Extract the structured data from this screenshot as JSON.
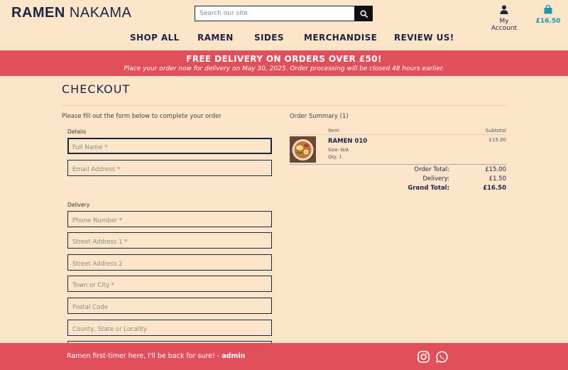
{
  "brand": {
    "name_bold": "RAMEN",
    "name_rest": "NAKAMA"
  },
  "search": {
    "placeholder": "Search our site",
    "icon": "search-icon"
  },
  "account": {
    "label": "My Account",
    "icon": "user-icon"
  },
  "cart": {
    "total": "£16.50",
    "icon": "shopping-bag-icon"
  },
  "nav": [
    "SHOP ALL",
    "RAMEN",
    "SIDES",
    "MERCHANDISE",
    "REVIEW US!"
  ],
  "banner": {
    "headline": "FREE DELIVERY ON ORDERS OVER £50!",
    "subline": "Place your order now for delivery on May 30, 2025. Order processing will be closed 48 hours earlier."
  },
  "page": {
    "title": "CHECKOUT",
    "intro": "Please fill out the form below to complete your order"
  },
  "form": {
    "details_label": "Details",
    "details_fields": [
      {
        "placeholder": "Full Name *",
        "value": ""
      },
      {
        "placeholder": "Email Address *",
        "value": ""
      }
    ],
    "delivery_label": "Delivery",
    "delivery_fields": [
      {
        "placeholder": "Phone Number *",
        "value": ""
      },
      {
        "placeholder": "Street Address 1 *",
        "value": ""
      },
      {
        "placeholder": "Street Address 2",
        "value": ""
      },
      {
        "placeholder": "Town or City *",
        "value": ""
      },
      {
        "placeholder": "Postal Code",
        "value": ""
      },
      {
        "placeholder": "County, State or Locality",
        "value": ""
      }
    ]
  },
  "summary": {
    "title": "Order Summary (1)",
    "col_item": "Item",
    "col_subtotal": "Subtotal",
    "items": [
      {
        "name": "RAMEN 010",
        "size": "Size: N/A",
        "qty": "Qty: 1",
        "price": "£15.00"
      }
    ],
    "totals": [
      {
        "label": "Order Total:",
        "value": "£15.00"
      },
      {
        "label": "Delivery:",
        "value": "£1.50"
      },
      {
        "label": "Grand Total:",
        "value": "£16.50"
      }
    ]
  },
  "footer": {
    "review_text": "Ramen first-timer here, I'll be back for sure! - ",
    "review_author": "admin",
    "social": [
      "instagram-icon",
      "whatsapp-icon"
    ]
  },
  "colors": {
    "background": "#fde5c9",
    "accent": "#e14f5b",
    "navy": "#1d2345",
    "teal": "#1a97a8"
  }
}
